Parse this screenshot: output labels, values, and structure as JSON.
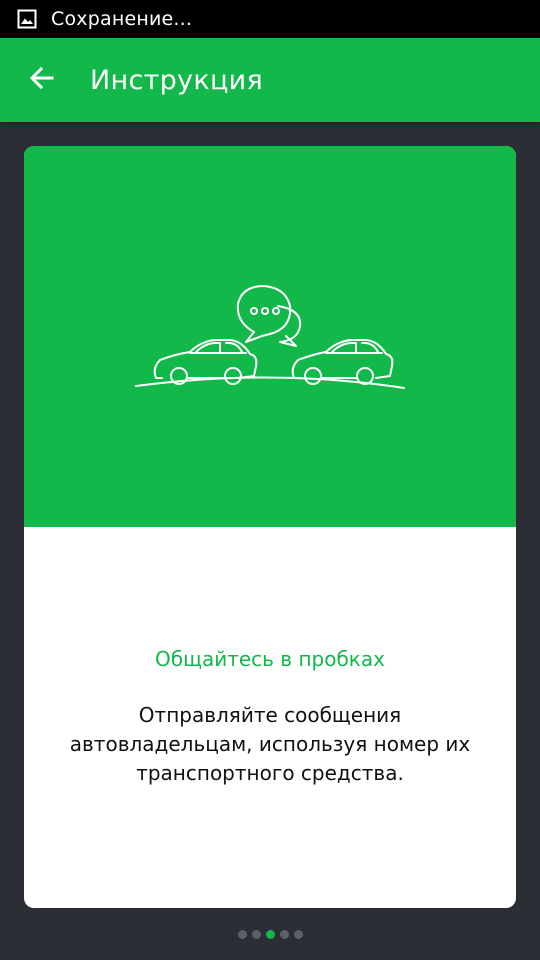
{
  "status_bar": {
    "notification_icon": "image-icon",
    "text": "Сохранение..."
  },
  "app_bar": {
    "back_icon": "arrow-left-icon",
    "title": "Инструкция"
  },
  "card": {
    "illustration": "cars-chat-illustration",
    "title": "Общайтесь в пробках",
    "description": "Отправляйте сообщения автовладельцам, используя номер их транспортного средства."
  },
  "pager": {
    "total": 5,
    "active_index": 2
  },
  "colors": {
    "accent": "#12b84a",
    "background": "#2b2f35",
    "status_bar": "#000000",
    "dot_inactive": "#5c6168"
  }
}
